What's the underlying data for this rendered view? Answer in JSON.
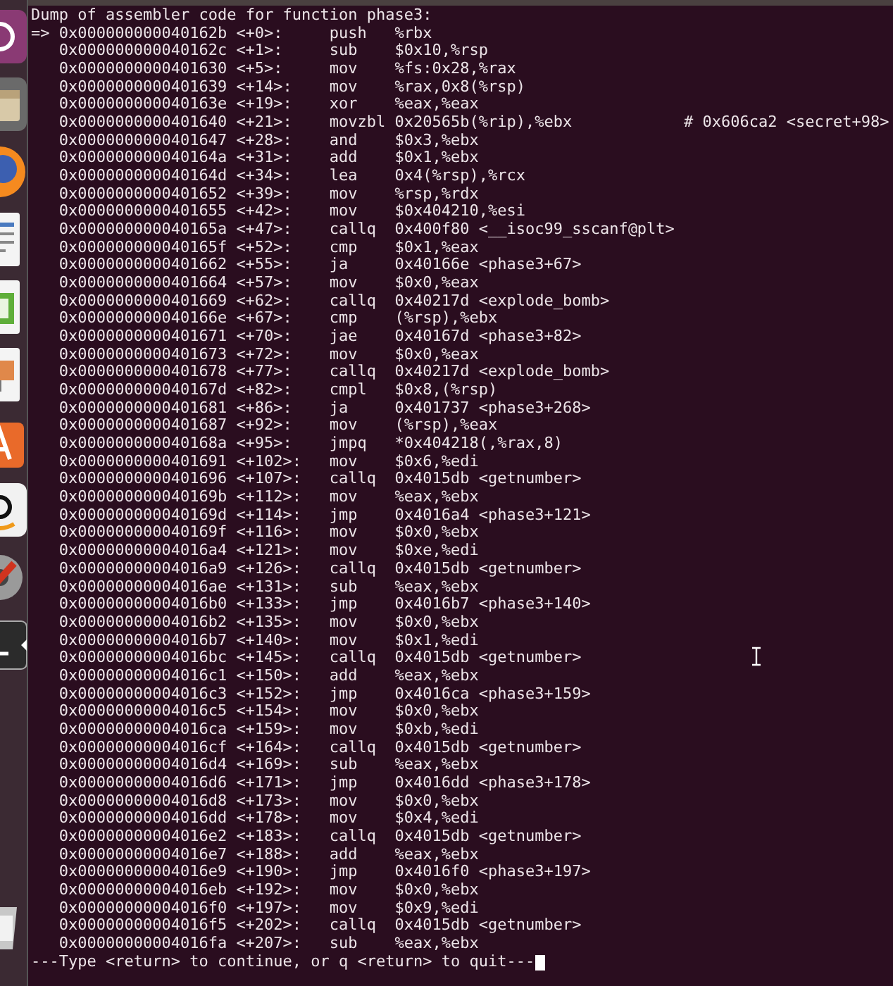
{
  "launcher": [
    {
      "kind": "dash",
      "active": false
    },
    {
      "kind": "files",
      "active": false
    },
    {
      "kind": "browser",
      "active": false
    },
    {
      "kind": "writer",
      "active": false
    },
    {
      "kind": "calc",
      "active": false
    },
    {
      "kind": "impress",
      "active": false
    },
    {
      "kind": "software",
      "active": false
    },
    {
      "kind": "amazon",
      "active": false
    },
    {
      "kind": "settings",
      "active": false
    },
    {
      "kind": "terminal",
      "active": true
    },
    {
      "kind": "trash",
      "active": false
    }
  ],
  "terminal": {
    "header": "Dump of assembler code for function phase3:",
    "current_marker": "=>",
    "rows": [
      {
        "address": "0x000000000040162b",
        "offset": "<+0>:",
        "mnemonic": "push",
        "operands": "%rbx",
        "current": true
      },
      {
        "address": "0x000000000040162c",
        "offset": "<+1>:",
        "mnemonic": "sub",
        "operands": "$0x10,%rsp",
        "current": false
      },
      {
        "address": "0x0000000000401630",
        "offset": "<+5>:",
        "mnemonic": "mov",
        "operands": "%fs:0x28,%rax",
        "current": false
      },
      {
        "address": "0x0000000000401639",
        "offset": "<+14>:",
        "mnemonic": "mov",
        "operands": "%rax,0x8(%rsp)",
        "current": false
      },
      {
        "address": "0x000000000040163e",
        "offset": "<+19>:",
        "mnemonic": "xor",
        "operands": "%eax,%eax",
        "current": false
      },
      {
        "address": "0x0000000000401640",
        "offset": "<+21>:",
        "mnemonic": "movzbl",
        "operands": "0x20565b(%rip),%ebx",
        "comment": "# 0x606ca2 <secret+98>",
        "current": false
      },
      {
        "address": "0x0000000000401647",
        "offset": "<+28>:",
        "mnemonic": "and",
        "operands": "$0x3,%ebx",
        "current": false
      },
      {
        "address": "0x000000000040164a",
        "offset": "<+31>:",
        "mnemonic": "add",
        "operands": "$0x1,%ebx",
        "current": false
      },
      {
        "address": "0x000000000040164d",
        "offset": "<+34>:",
        "mnemonic": "lea",
        "operands": "0x4(%rsp),%rcx",
        "current": false
      },
      {
        "address": "0x0000000000401652",
        "offset": "<+39>:",
        "mnemonic": "mov",
        "operands": "%rsp,%rdx",
        "current": false
      },
      {
        "address": "0x0000000000401655",
        "offset": "<+42>:",
        "mnemonic": "mov",
        "operands": "$0x404210,%esi",
        "current": false
      },
      {
        "address": "0x000000000040165a",
        "offset": "<+47>:",
        "mnemonic": "callq",
        "operands": "0x400f80 <__isoc99_sscanf@plt>",
        "current": false
      },
      {
        "address": "0x000000000040165f",
        "offset": "<+52>:",
        "mnemonic": "cmp",
        "operands": "$0x1,%eax",
        "current": false
      },
      {
        "address": "0x0000000000401662",
        "offset": "<+55>:",
        "mnemonic": "ja",
        "operands": "0x40166e <phase3+67>",
        "current": false
      },
      {
        "address": "0x0000000000401664",
        "offset": "<+57>:",
        "mnemonic": "mov",
        "operands": "$0x0,%eax",
        "current": false
      },
      {
        "address": "0x0000000000401669",
        "offset": "<+62>:",
        "mnemonic": "callq",
        "operands": "0x40217d <explode_bomb>",
        "current": false
      },
      {
        "address": "0x000000000040166e",
        "offset": "<+67>:",
        "mnemonic": "cmp",
        "operands": "(%rsp),%ebx",
        "current": false
      },
      {
        "address": "0x0000000000401671",
        "offset": "<+70>:",
        "mnemonic": "jae",
        "operands": "0x40167d <phase3+82>",
        "current": false
      },
      {
        "address": "0x0000000000401673",
        "offset": "<+72>:",
        "mnemonic": "mov",
        "operands": "$0x0,%eax",
        "current": false
      },
      {
        "address": "0x0000000000401678",
        "offset": "<+77>:",
        "mnemonic": "callq",
        "operands": "0x40217d <explode_bomb>",
        "current": false
      },
      {
        "address": "0x000000000040167d",
        "offset": "<+82>:",
        "mnemonic": "cmpl",
        "operands": "$0x8,(%rsp)",
        "current": false
      },
      {
        "address": "0x0000000000401681",
        "offset": "<+86>:",
        "mnemonic": "ja",
        "operands": "0x401737 <phase3+268>",
        "current": false
      },
      {
        "address": "0x0000000000401687",
        "offset": "<+92>:",
        "mnemonic": "mov",
        "operands": "(%rsp),%eax",
        "current": false
      },
      {
        "address": "0x000000000040168a",
        "offset": "<+95>:",
        "mnemonic": "jmpq",
        "operands": "*0x404218(,%rax,8)",
        "current": false
      },
      {
        "address": "0x0000000000401691",
        "offset": "<+102>:",
        "mnemonic": "mov",
        "operands": "$0x6,%edi",
        "current": false
      },
      {
        "address": "0x0000000000401696",
        "offset": "<+107>:",
        "mnemonic": "callq",
        "operands": "0x4015db <getnumber>",
        "current": false
      },
      {
        "address": "0x000000000040169b",
        "offset": "<+112>:",
        "mnemonic": "mov",
        "operands": "%eax,%ebx",
        "current": false
      },
      {
        "address": "0x000000000040169d",
        "offset": "<+114>:",
        "mnemonic": "jmp",
        "operands": "0x4016a4 <phase3+121>",
        "current": false
      },
      {
        "address": "0x000000000040169f",
        "offset": "<+116>:",
        "mnemonic": "mov",
        "operands": "$0x0,%ebx",
        "current": false
      },
      {
        "address": "0x00000000004016a4",
        "offset": "<+121>:",
        "mnemonic": "mov",
        "operands": "$0xe,%edi",
        "current": false
      },
      {
        "address": "0x00000000004016a9",
        "offset": "<+126>:",
        "mnemonic": "callq",
        "operands": "0x4015db <getnumber>",
        "current": false
      },
      {
        "address": "0x00000000004016ae",
        "offset": "<+131>:",
        "mnemonic": "sub",
        "operands": "%eax,%ebx",
        "current": false
      },
      {
        "address": "0x00000000004016b0",
        "offset": "<+133>:",
        "mnemonic": "jmp",
        "operands": "0x4016b7 <phase3+140>",
        "current": false
      },
      {
        "address": "0x00000000004016b2",
        "offset": "<+135>:",
        "mnemonic": "mov",
        "operands": "$0x0,%ebx",
        "current": false
      },
      {
        "address": "0x00000000004016b7",
        "offset": "<+140>:",
        "mnemonic": "mov",
        "operands": "$0x1,%edi",
        "current": false
      },
      {
        "address": "0x00000000004016bc",
        "offset": "<+145>:",
        "mnemonic": "callq",
        "operands": "0x4015db <getnumber>",
        "current": false
      },
      {
        "address": "0x00000000004016c1",
        "offset": "<+150>:",
        "mnemonic": "add",
        "operands": "%eax,%ebx",
        "current": false
      },
      {
        "address": "0x00000000004016c3",
        "offset": "<+152>:",
        "mnemonic": "jmp",
        "operands": "0x4016ca <phase3+159>",
        "current": false
      },
      {
        "address": "0x00000000004016c5",
        "offset": "<+154>:",
        "mnemonic": "mov",
        "operands": "$0x0,%ebx",
        "current": false
      },
      {
        "address": "0x00000000004016ca",
        "offset": "<+159>:",
        "mnemonic": "mov",
        "operands": "$0xb,%edi",
        "current": false
      },
      {
        "address": "0x00000000004016cf",
        "offset": "<+164>:",
        "mnemonic": "callq",
        "operands": "0x4015db <getnumber>",
        "current": false
      },
      {
        "address": "0x00000000004016d4",
        "offset": "<+169>:",
        "mnemonic": "sub",
        "operands": "%eax,%ebx",
        "current": false
      },
      {
        "address": "0x00000000004016d6",
        "offset": "<+171>:",
        "mnemonic": "jmp",
        "operands": "0x4016dd <phase3+178>",
        "current": false
      },
      {
        "address": "0x00000000004016d8",
        "offset": "<+173>:",
        "mnemonic": "mov",
        "operands": "$0x0,%ebx",
        "current": false
      },
      {
        "address": "0x00000000004016dd",
        "offset": "<+178>:",
        "mnemonic": "mov",
        "operands": "$0x4,%edi",
        "current": false
      },
      {
        "address": "0x00000000004016e2",
        "offset": "<+183>:",
        "mnemonic": "callq",
        "operands": "0x4015db <getnumber>",
        "current": false
      },
      {
        "address": "0x00000000004016e7",
        "offset": "<+188>:",
        "mnemonic": "add",
        "operands": "%eax,%ebx",
        "current": false
      },
      {
        "address": "0x00000000004016e9",
        "offset": "<+190>:",
        "mnemonic": "jmp",
        "operands": "0x4016f0 <phase3+197>",
        "current": false
      },
      {
        "address": "0x00000000004016eb",
        "offset": "<+192>:",
        "mnemonic": "mov",
        "operands": "$0x0,%ebx",
        "current": false
      },
      {
        "address": "0x00000000004016f0",
        "offset": "<+197>:",
        "mnemonic": "mov",
        "operands": "$0x9,%edi",
        "current": false
      },
      {
        "address": "0x00000000004016f5",
        "offset": "<+202>:",
        "mnemonic": "callq",
        "operands": "0x4015db <getnumber>",
        "current": false
      },
      {
        "address": "0x00000000004016fa",
        "offset": "<+207>:",
        "mnemonic": "sub",
        "operands": "%eax,%ebx",
        "current": false
      }
    ],
    "pager_prompt": "---Type <return> to continue, or q <return> to quit---"
  }
}
